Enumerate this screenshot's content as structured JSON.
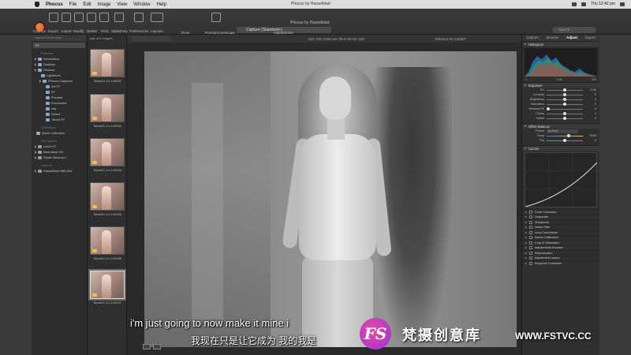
{
  "menubar": {
    "app_name": "Phocus",
    "menus": [
      "File",
      "Edit",
      "Image",
      "View",
      "Window",
      "Help"
    ],
    "window_title": "Phocus by Hasselblad",
    "clock": "Thu 12:42 pm"
  },
  "toolbar": {
    "buttons": [
      "Capture",
      "Export",
      "Import",
      "Modify",
      "Delete",
      "Print",
      "Slideshow",
      "Preferences",
      "Layouts",
      "Show",
      "Portrait/Landscape",
      "Adjustments",
      "Search"
    ],
    "preset": "Capture (Standard+)",
    "search_placeholder": "Search"
  },
  "left_panel": {
    "header": "Capture Destination",
    "selected": "FF",
    "section_favorites": "Favorites",
    "items": [
      "Information",
      "Desktop",
      "Pictures",
      "Lightroom",
      "Phocus Captures",
      "Art FF",
      "FF",
      "Preview",
      "Processed",
      "raw",
      "Select",
      "Tahari FF"
    ],
    "section_collections": "Collections",
    "quick_collection": "Quick Collection",
    "section_file_system": "File System",
    "volumes": [
      "LaCie 1T",
      "Macintosh HD",
      "Studio Backup 1"
    ],
    "section_network": "Network",
    "network_items": [
      "Hasselblad H6D-50c"
    ]
  },
  "thumbnails": {
    "header": "pair of 6 images",
    "items": [
      "Tahari21-01-140002",
      "Tahari21-01-140003",
      "Tahari21-01-140004",
      "Tahari21-01-140005",
      "Tahari21-01-140006",
      "Tahari21-01-140007"
    ],
    "selected_index": 5
  },
  "viewer": {
    "exif": "ISO 100  1/160 sec  f/8.0  H6  HC 100",
    "image_name": "Tahari21-01-140007"
  },
  "right_panel": {
    "tabs": [
      "Capture",
      "Browse",
      "Adjust",
      "Export"
    ],
    "active_tab": "Adjust",
    "histogram_title": "Histogram",
    "histogram_values": [
      "1",
      "0.95",
      "255"
    ],
    "exposure_title": "Exposure",
    "exposure_sliders": [
      {
        "label": "EV",
        "value": "0.00"
      },
      {
        "label": "Contrast",
        "value": "0"
      },
      {
        "label": "Brightness",
        "value": "0"
      },
      {
        "label": "Saturation",
        "value": "0"
      },
      {
        "label": "Shadow Fill",
        "value": "0"
      },
      {
        "label": "Clarity",
        "value": "0"
      },
      {
        "label": "Detail",
        "value": "0"
      }
    ],
    "wb_title": "White Balance",
    "wb_rows": [
      {
        "label": "Preset",
        "value": "As Shot"
      },
      {
        "label": "Temp",
        "value": "5000"
      },
      {
        "label": "Tint",
        "value": "0"
      }
    ],
    "curves_title": "Curves",
    "tools": [
      "Color Correction",
      "Grayscale",
      "Sharpness",
      "Noise Filter",
      "Lens Corrections",
      "Scene Calibration",
      "Crop & Orientation",
      "Adjustments Browser",
      "Reproduction",
      "Adjustment Layers",
      "Keystone Correction"
    ]
  },
  "subtitles": {
    "en": "i'm just going to now make it mine i",
    "cn": "我现在只是让它成为 我的我是"
  },
  "watermark": {
    "logo_letter": "FS",
    "text": "梵摄创意库",
    "url": "WWW.FSTVC.CC"
  }
}
